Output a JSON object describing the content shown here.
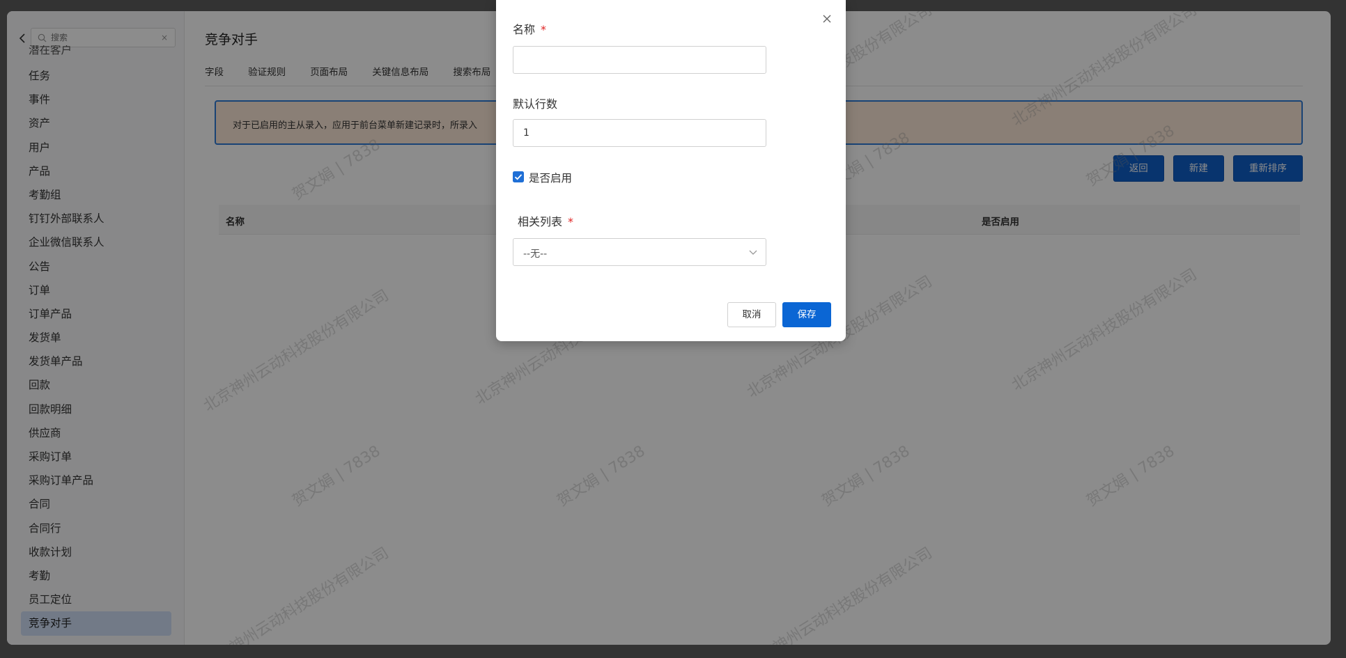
{
  "sidebar": {
    "search_placeholder": "搜索",
    "clear": "×",
    "cut_item": "潜在客户",
    "items": [
      "任务",
      "事件",
      "资产",
      "用户",
      "产品",
      "考勤组",
      "钉钉外部联系人",
      "企业微信联系人",
      "公告",
      "订单",
      "订单产品",
      "发货单",
      "发货单产品",
      "回款",
      "回款明细",
      "供应商",
      "采购订单",
      "采购订单产品",
      "合同",
      "合同行",
      "收款计划",
      "考勤",
      "员工定位"
    ],
    "active_item": "竞争对手"
  },
  "main": {
    "title": "竞争对手",
    "tabs": [
      "字段",
      "验证规则",
      "页面布局",
      "关键信息布局",
      "搜索布局"
    ],
    "notice": "对于已启用的主从录入，应用于前台菜单新建记录时，所录入",
    "buttons": {
      "back": "返回",
      "new": "新建",
      "reorder": "重新排序"
    },
    "table_headers": {
      "name": "名称",
      "enabled": "是否启用"
    }
  },
  "watermark": {
    "company": "北京神州云动科技股份有限公司",
    "user": "贺文娟 | 7838"
  },
  "modal": {
    "name_label": "名称",
    "required_mark": "*",
    "name_value": "",
    "rows_label": "默认行数",
    "rows_value": "1",
    "enabled_label": "是否启用",
    "enabled_checked": true,
    "related_label": "相关列表",
    "related_value": "--无--",
    "cancel": "取消",
    "save": "保存"
  },
  "colors": {
    "primary": "#0b66d4",
    "required": "#e02424",
    "active_menu": "#cfdff6"
  }
}
